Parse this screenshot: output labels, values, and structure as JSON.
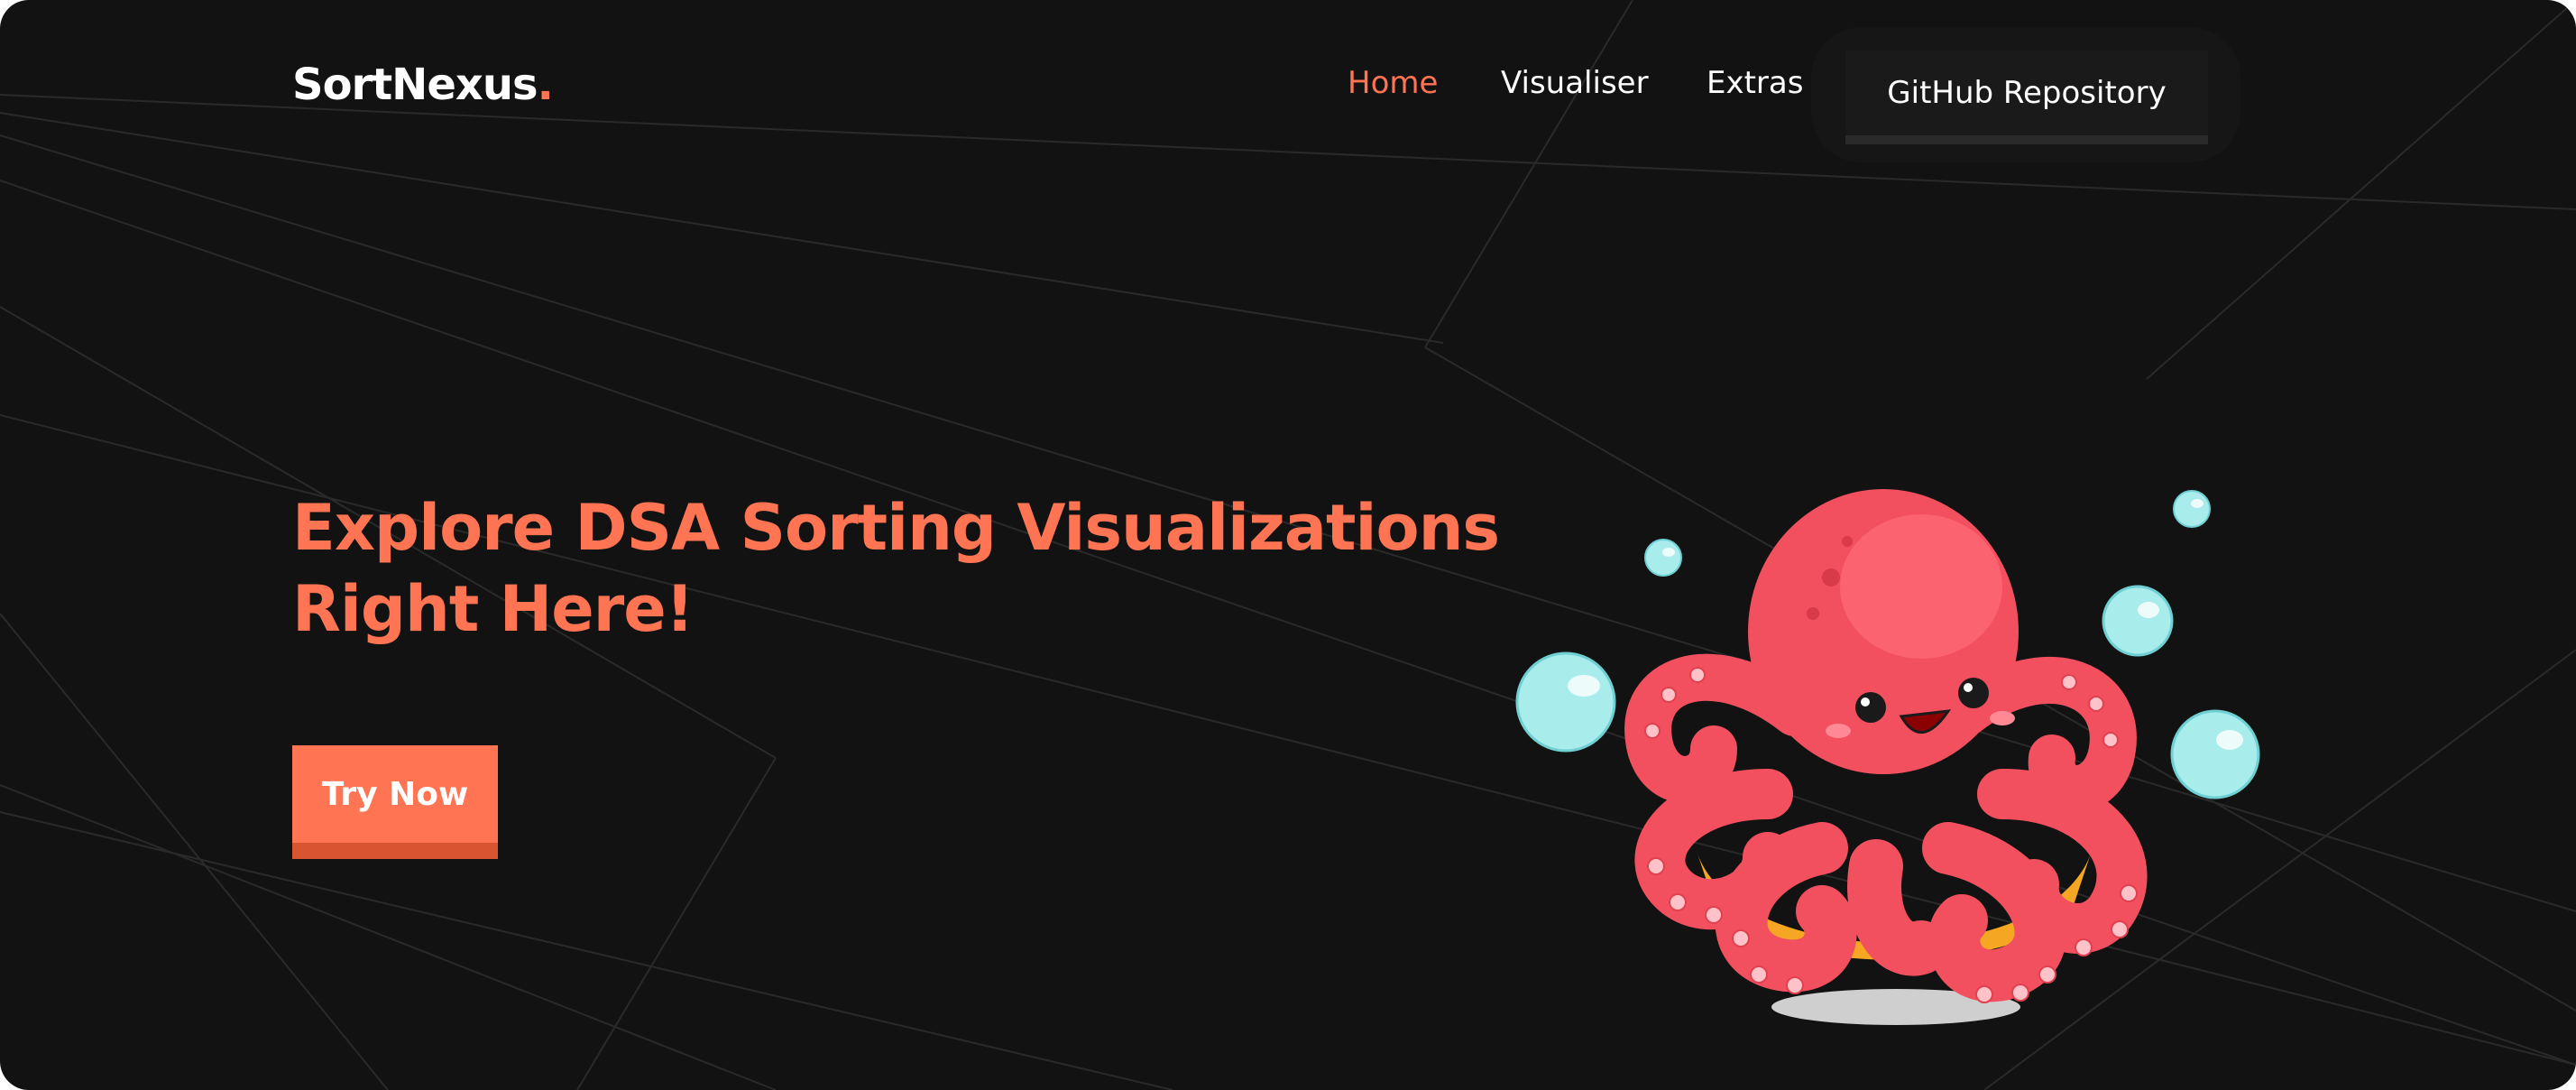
{
  "brand": {
    "name": "SortNexus",
    "dot": "."
  },
  "nav": {
    "items": [
      {
        "label": "Home",
        "active": true
      },
      {
        "label": "Visualiser",
        "active": false
      },
      {
        "label": "Extras",
        "active": false
      }
    ],
    "github_label": "GitHub Repository"
  },
  "hero": {
    "title_line1": "Explore DSA Sorting Visualizations",
    "title_line2": "Right Here!",
    "cta_label": "Try Now"
  },
  "colors": {
    "accent": "#ff7452",
    "background": "#121212",
    "octopus_body": "#f2505f",
    "bubble": "#a8ecec"
  },
  "icons": {
    "illustration": "octopus-illustration"
  }
}
